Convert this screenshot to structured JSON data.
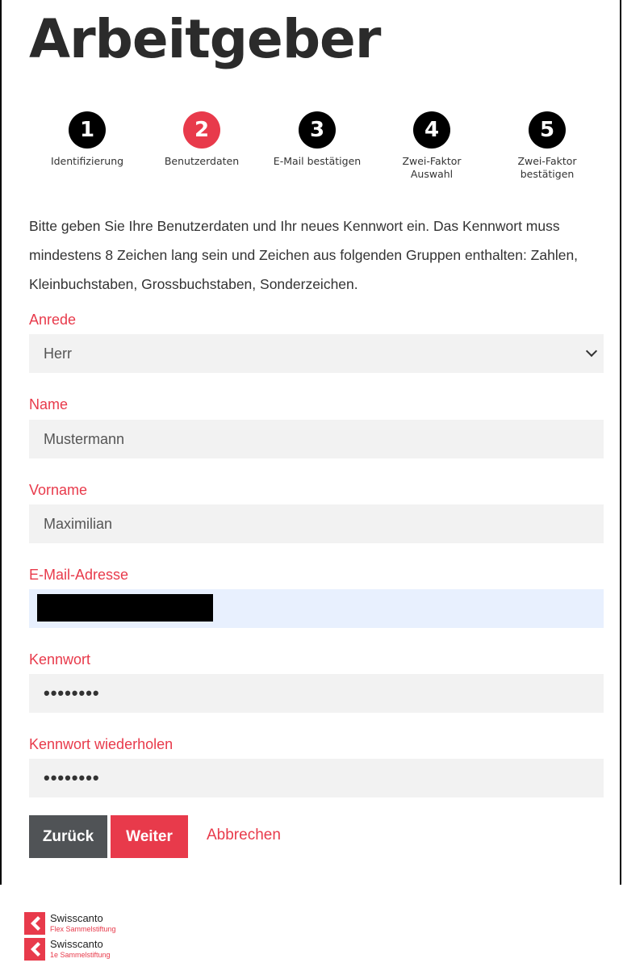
{
  "page": {
    "title": "Arbeitgeber"
  },
  "steps": [
    {
      "number": "1",
      "label": "Identifizierung"
    },
    {
      "number": "2",
      "label": "Benutzerdaten"
    },
    {
      "number": "3",
      "label": "E-Mail bestätigen"
    },
    {
      "number": "4",
      "label": "Zwei-Faktor Auswahl"
    },
    {
      "number": "5",
      "label": "Zwei-Faktor bestätigen"
    }
  ],
  "active_step": 2,
  "intro": "Bitte geben Sie Ihre Benutzerdaten und Ihr neues Kennwort ein. Das Kennwort muss mindestens 8 Zeichen lang sein und Zeichen aus folgenden Gruppen enthalten: Zahlen, Kleinbuchstaben, Grossbuchstaben, Sonderzeichen.",
  "form": {
    "salutation": {
      "label": "Anrede",
      "value": "Herr"
    },
    "last_name": {
      "label": "Name",
      "value": "Mustermann"
    },
    "first_name": {
      "label": "Vorname",
      "value": "Maximilian"
    },
    "email": {
      "label": "E-Mail-Adresse",
      "value": ""
    },
    "password": {
      "label": "Kennwort",
      "value": "••••••••"
    },
    "password_repeat": {
      "label": "Kennwort wiederholen",
      "value": "••••••••"
    }
  },
  "buttons": {
    "back": "Zurück",
    "next": "Weiter",
    "cancel": "Abbrechen"
  },
  "logos": [
    {
      "name": "Swisscanto",
      "subtitle": "Flex Sammelstiftung"
    },
    {
      "name": "Swisscanto",
      "subtitle": "1e Sammelstiftung"
    }
  ],
  "colors": {
    "accent": "#e83a4b",
    "step": "#000000",
    "field_bg": "#f2f2f2",
    "autofill_bg": "#e8f0fe",
    "back_button": "#505356"
  },
  "icons": {
    "select": "chevron-down-icon",
    "logo": "swisscanto-logo-icon"
  }
}
